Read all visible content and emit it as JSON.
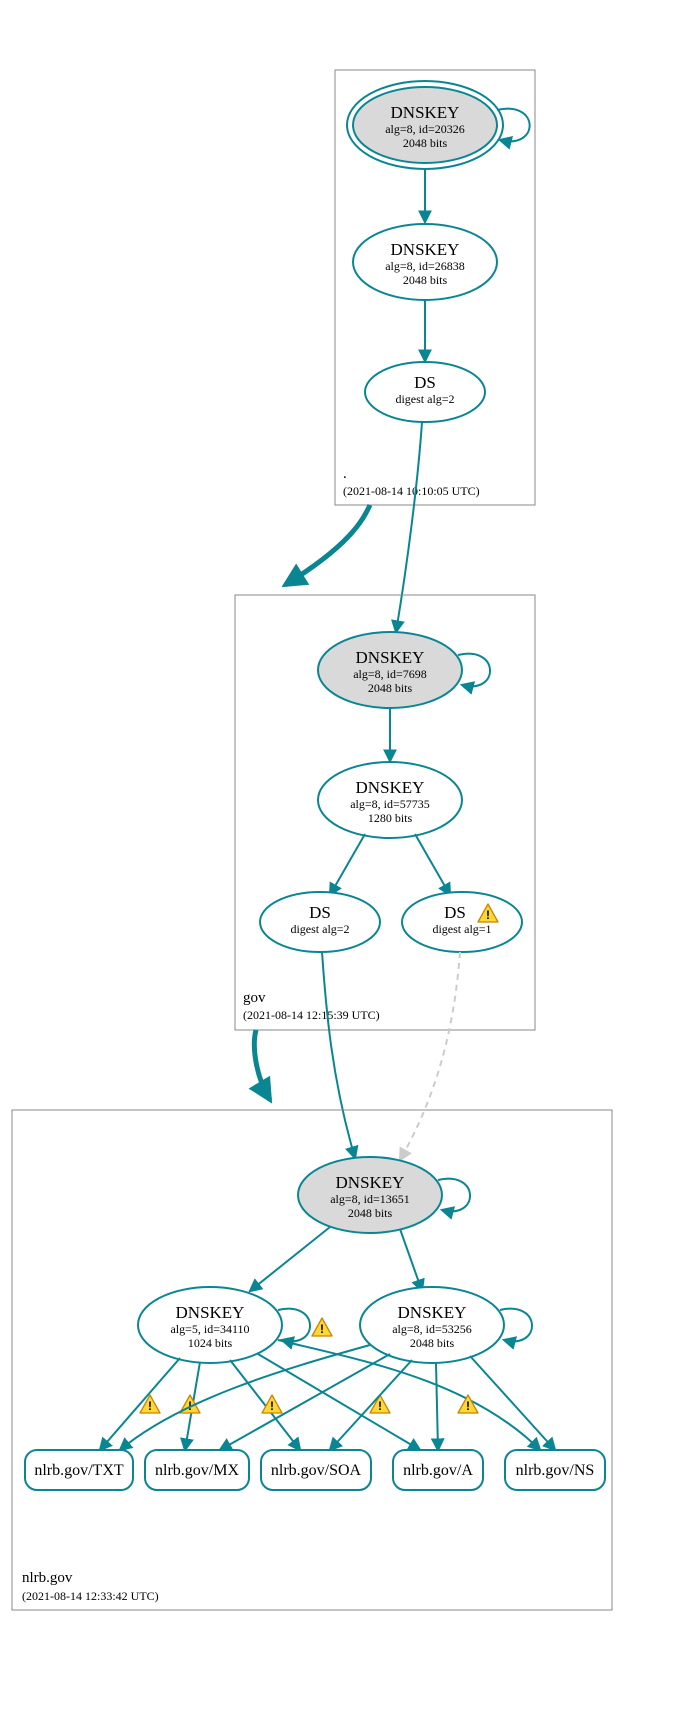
{
  "zones": {
    "root": {
      "label": ".",
      "timestamp": "(2021-08-14 10:10:05 UTC)"
    },
    "gov": {
      "label": "gov",
      "timestamp": "(2021-08-14 12:15:39 UTC)"
    },
    "nlrb": {
      "label": "nlrb.gov",
      "timestamp": "(2021-08-14 12:33:42 UTC)"
    }
  },
  "nodes": {
    "root_ksk": {
      "title": "DNSKEY",
      "sub1": "alg=8, id=20326",
      "sub2": "2048 bits"
    },
    "root_zsk": {
      "title": "DNSKEY",
      "sub1": "alg=8, id=26838",
      "sub2": "2048 bits"
    },
    "root_ds": {
      "title": "DS",
      "sub1": "digest alg=2"
    },
    "gov_ksk": {
      "title": "DNSKEY",
      "sub1": "alg=8, id=7698",
      "sub2": "2048 bits"
    },
    "gov_zsk": {
      "title": "DNSKEY",
      "sub1": "alg=8, id=57735",
      "sub2": "1280 bits"
    },
    "gov_ds2": {
      "title": "DS",
      "sub1": "digest alg=2"
    },
    "gov_ds1": {
      "title": "DS",
      "sub1": "digest alg=1"
    },
    "nlrb_ksk": {
      "title": "DNSKEY",
      "sub1": "alg=8, id=13651",
      "sub2": "2048 bits"
    },
    "nlrb_zsk_a": {
      "title": "DNSKEY",
      "sub1": "alg=5, id=34110",
      "sub2": "1024 bits"
    },
    "nlrb_zsk_b": {
      "title": "DNSKEY",
      "sub1": "alg=8, id=53256",
      "sub2": "2048 bits"
    },
    "rr_txt": {
      "label": "nlrb.gov/TXT"
    },
    "rr_mx": {
      "label": "nlrb.gov/MX"
    },
    "rr_soa": {
      "label": "nlrb.gov/SOA"
    },
    "rr_a": {
      "label": "nlrb.gov/A"
    },
    "rr_ns": {
      "label": "nlrb.gov/NS"
    }
  },
  "chart_data": {
    "type": "diagram",
    "description": "DNSSEC authentication/delegation tree (DNSViz style)",
    "zones": [
      {
        "name": ".",
        "timestamp": "2021-08-14 10:10:05 UTC"
      },
      {
        "name": "gov",
        "timestamp": "2021-08-14 12:15:39 UTC"
      },
      {
        "name": "nlrb.gov",
        "timestamp": "2021-08-14 12:33:42 UTC"
      }
    ],
    "nodes": [
      {
        "id": "root_ksk",
        "zone": ".",
        "type": "DNSKEY",
        "alg": 8,
        "key_id": 20326,
        "bits": 2048,
        "ksk": true,
        "self_loop": true
      },
      {
        "id": "root_zsk",
        "zone": ".",
        "type": "DNSKEY",
        "alg": 8,
        "key_id": 26838,
        "bits": 2048,
        "ksk": false
      },
      {
        "id": "root_ds",
        "zone": ".",
        "type": "DS",
        "digest_alg": 2
      },
      {
        "id": "gov_ksk",
        "zone": "gov",
        "type": "DNSKEY",
        "alg": 8,
        "key_id": 7698,
        "bits": 2048,
        "ksk": true,
        "self_loop": true
      },
      {
        "id": "gov_zsk",
        "zone": "gov",
        "type": "DNSKEY",
        "alg": 8,
        "key_id": 57735,
        "bits": 1280,
        "ksk": false
      },
      {
        "id": "gov_ds2",
        "zone": "gov",
        "type": "DS",
        "digest_alg": 2
      },
      {
        "id": "gov_ds1",
        "zone": "gov",
        "type": "DS",
        "digest_alg": 1,
        "warning": true
      },
      {
        "id": "nlrb_ksk",
        "zone": "nlrb.gov",
        "type": "DNSKEY",
        "alg": 8,
        "key_id": 13651,
        "bits": 2048,
        "ksk": true,
        "self_loop": true
      },
      {
        "id": "nlrb_zsk_a",
        "zone": "nlrb.gov",
        "type": "DNSKEY",
        "alg": 5,
        "key_id": 34110,
        "bits": 1024,
        "self_loop": true,
        "self_loop_warning": true
      },
      {
        "id": "nlrb_zsk_b",
        "zone": "nlrb.gov",
        "type": "DNSKEY",
        "alg": 8,
        "key_id": 53256,
        "bits": 2048,
        "self_loop": true
      },
      {
        "id": "rr_txt",
        "zone": "nlrb.gov",
        "type": "RRset",
        "label": "nlrb.gov/TXT"
      },
      {
        "id": "rr_mx",
        "zone": "nlrb.gov",
        "type": "RRset",
        "label": "nlrb.gov/MX"
      },
      {
        "id": "rr_soa",
        "zone": "nlrb.gov",
        "type": "RRset",
        "label": "nlrb.gov/SOA"
      },
      {
        "id": "rr_a",
        "zone": "nlrb.gov",
        "type": "RRset",
        "label": "nlrb.gov/A"
      },
      {
        "id": "rr_ns",
        "zone": "nlrb.gov",
        "type": "RRset",
        "label": "nlrb.gov/NS"
      }
    ],
    "edges": [
      {
        "from": "root_ksk",
        "to": "root_zsk",
        "style": "solid"
      },
      {
        "from": "root_zsk",
        "to": "root_ds",
        "style": "solid"
      },
      {
        "from": "root_ds",
        "to": "gov_ksk",
        "style": "solid"
      },
      {
        "from": ".",
        "to": "gov",
        "style": "thick",
        "kind": "delegation"
      },
      {
        "from": "gov_ksk",
        "to": "gov_zsk",
        "style": "solid"
      },
      {
        "from": "gov_zsk",
        "to": "gov_ds2",
        "style": "solid"
      },
      {
        "from": "gov_zsk",
        "to": "gov_ds1",
        "style": "solid"
      },
      {
        "from": "gov_ds2",
        "to": "nlrb_ksk",
        "style": "solid"
      },
      {
        "from": "gov_ds1",
        "to": "nlrb_ksk",
        "style": "dashed"
      },
      {
        "from": "gov",
        "to": "nlrb.gov",
        "style": "thick",
        "kind": "delegation"
      },
      {
        "from": "nlrb_ksk",
        "to": "nlrb_zsk_a",
        "style": "solid"
      },
      {
        "from": "nlrb_ksk",
        "to": "nlrb_zsk_b",
        "style": "solid"
      },
      {
        "from": "nlrb_zsk_a",
        "to": "rr_txt",
        "style": "solid",
        "warning": true
      },
      {
        "from": "nlrb_zsk_a",
        "to": "rr_mx",
        "style": "solid",
        "warning": true
      },
      {
        "from": "nlrb_zsk_a",
        "to": "rr_soa",
        "style": "solid",
        "warning": true
      },
      {
        "from": "nlrb_zsk_a",
        "to": "rr_a",
        "style": "solid",
        "warning": true
      },
      {
        "from": "nlrb_zsk_a",
        "to": "rr_ns",
        "style": "solid",
        "warning": true
      },
      {
        "from": "nlrb_zsk_b",
        "to": "rr_txt",
        "style": "solid"
      },
      {
        "from": "nlrb_zsk_b",
        "to": "rr_mx",
        "style": "solid"
      },
      {
        "from": "nlrb_zsk_b",
        "to": "rr_soa",
        "style": "solid"
      },
      {
        "from": "nlrb_zsk_b",
        "to": "rr_a",
        "style": "solid"
      },
      {
        "from": "nlrb_zsk_b",
        "to": "rr_ns",
        "style": "solid"
      }
    ]
  }
}
